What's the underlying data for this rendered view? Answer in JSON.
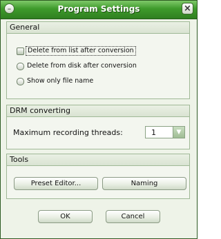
{
  "window": {
    "title": "Program Settings"
  },
  "general": {
    "title": "General",
    "options": [
      {
        "label": "Delete from list after conversion"
      },
      {
        "label": "Delete from disk after conversion"
      },
      {
        "label": "Show only file name"
      }
    ]
  },
  "drm": {
    "title": "DRM converting",
    "threads_label": "Maximum recording threads:",
    "threads_value": "1"
  },
  "tools": {
    "title": "Tools",
    "preset_label": "Preset Editor...",
    "naming_label": "Naming"
  },
  "dialog": {
    "ok_label": "OK",
    "cancel_label": "Cancel"
  }
}
